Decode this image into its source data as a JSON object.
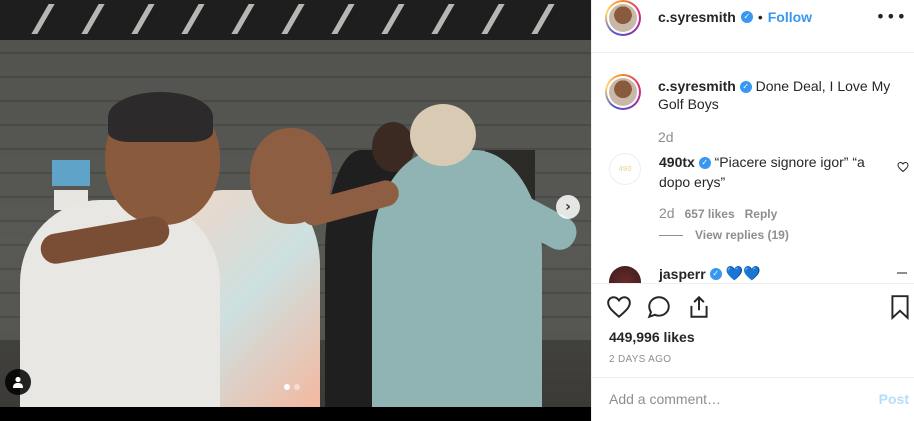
{
  "post": {
    "username": "c.syresmith",
    "follow_label": "Follow",
    "dot_separator": "•",
    "more_icon": "more-options-icon",
    "carousel": {
      "slides": 2,
      "active_slide": 1
    }
  },
  "caption": {
    "username": "c.syresmith",
    "text": "Done Deal, I Love My Golf Boys",
    "time": "2d"
  },
  "comments": [
    {
      "username": "490tx",
      "text": "“Piacere signore igor” “a dopo erys”",
      "time": "2d",
      "likes": "657 likes",
      "reply_label": "Reply",
      "view_replies": "View replies (19)"
    },
    {
      "username": "jasperr",
      "text": "💙💙"
    }
  ],
  "actions": {
    "likes": "449,996 likes",
    "date": "2 DAYS AGO"
  },
  "add_comment": {
    "placeholder": "Add a comment…",
    "post_label": "Post"
  },
  "colors": {
    "accent": "#3897f0",
    "muted": "#8e8e8e",
    "post_disabled": "#b2dffc"
  }
}
